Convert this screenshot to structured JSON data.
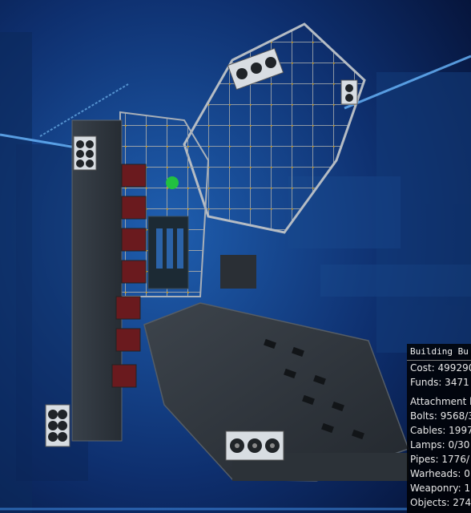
{
  "budget_panel": {
    "title": "Building Bu",
    "cost": "Cost: 499290",
    "funds": "Funds: 3471",
    "attachment_header": "Attachment l",
    "bolts": "Bolts: 9568/3",
    "cables": "Cables: 1997",
    "lamps": "Lamps: 0/30",
    "pipes": "Pipes: 1776/",
    "warheads": "Warheads: 0",
    "weaponry": "Weaponry: 1",
    "objects": "Objects: 274"
  },
  "colors": {
    "background": "#0a1a3a",
    "hull": "#2a3038",
    "frame": "#8a9098",
    "bolt_accent": "#d4a020",
    "panel_bg": "#000000"
  }
}
